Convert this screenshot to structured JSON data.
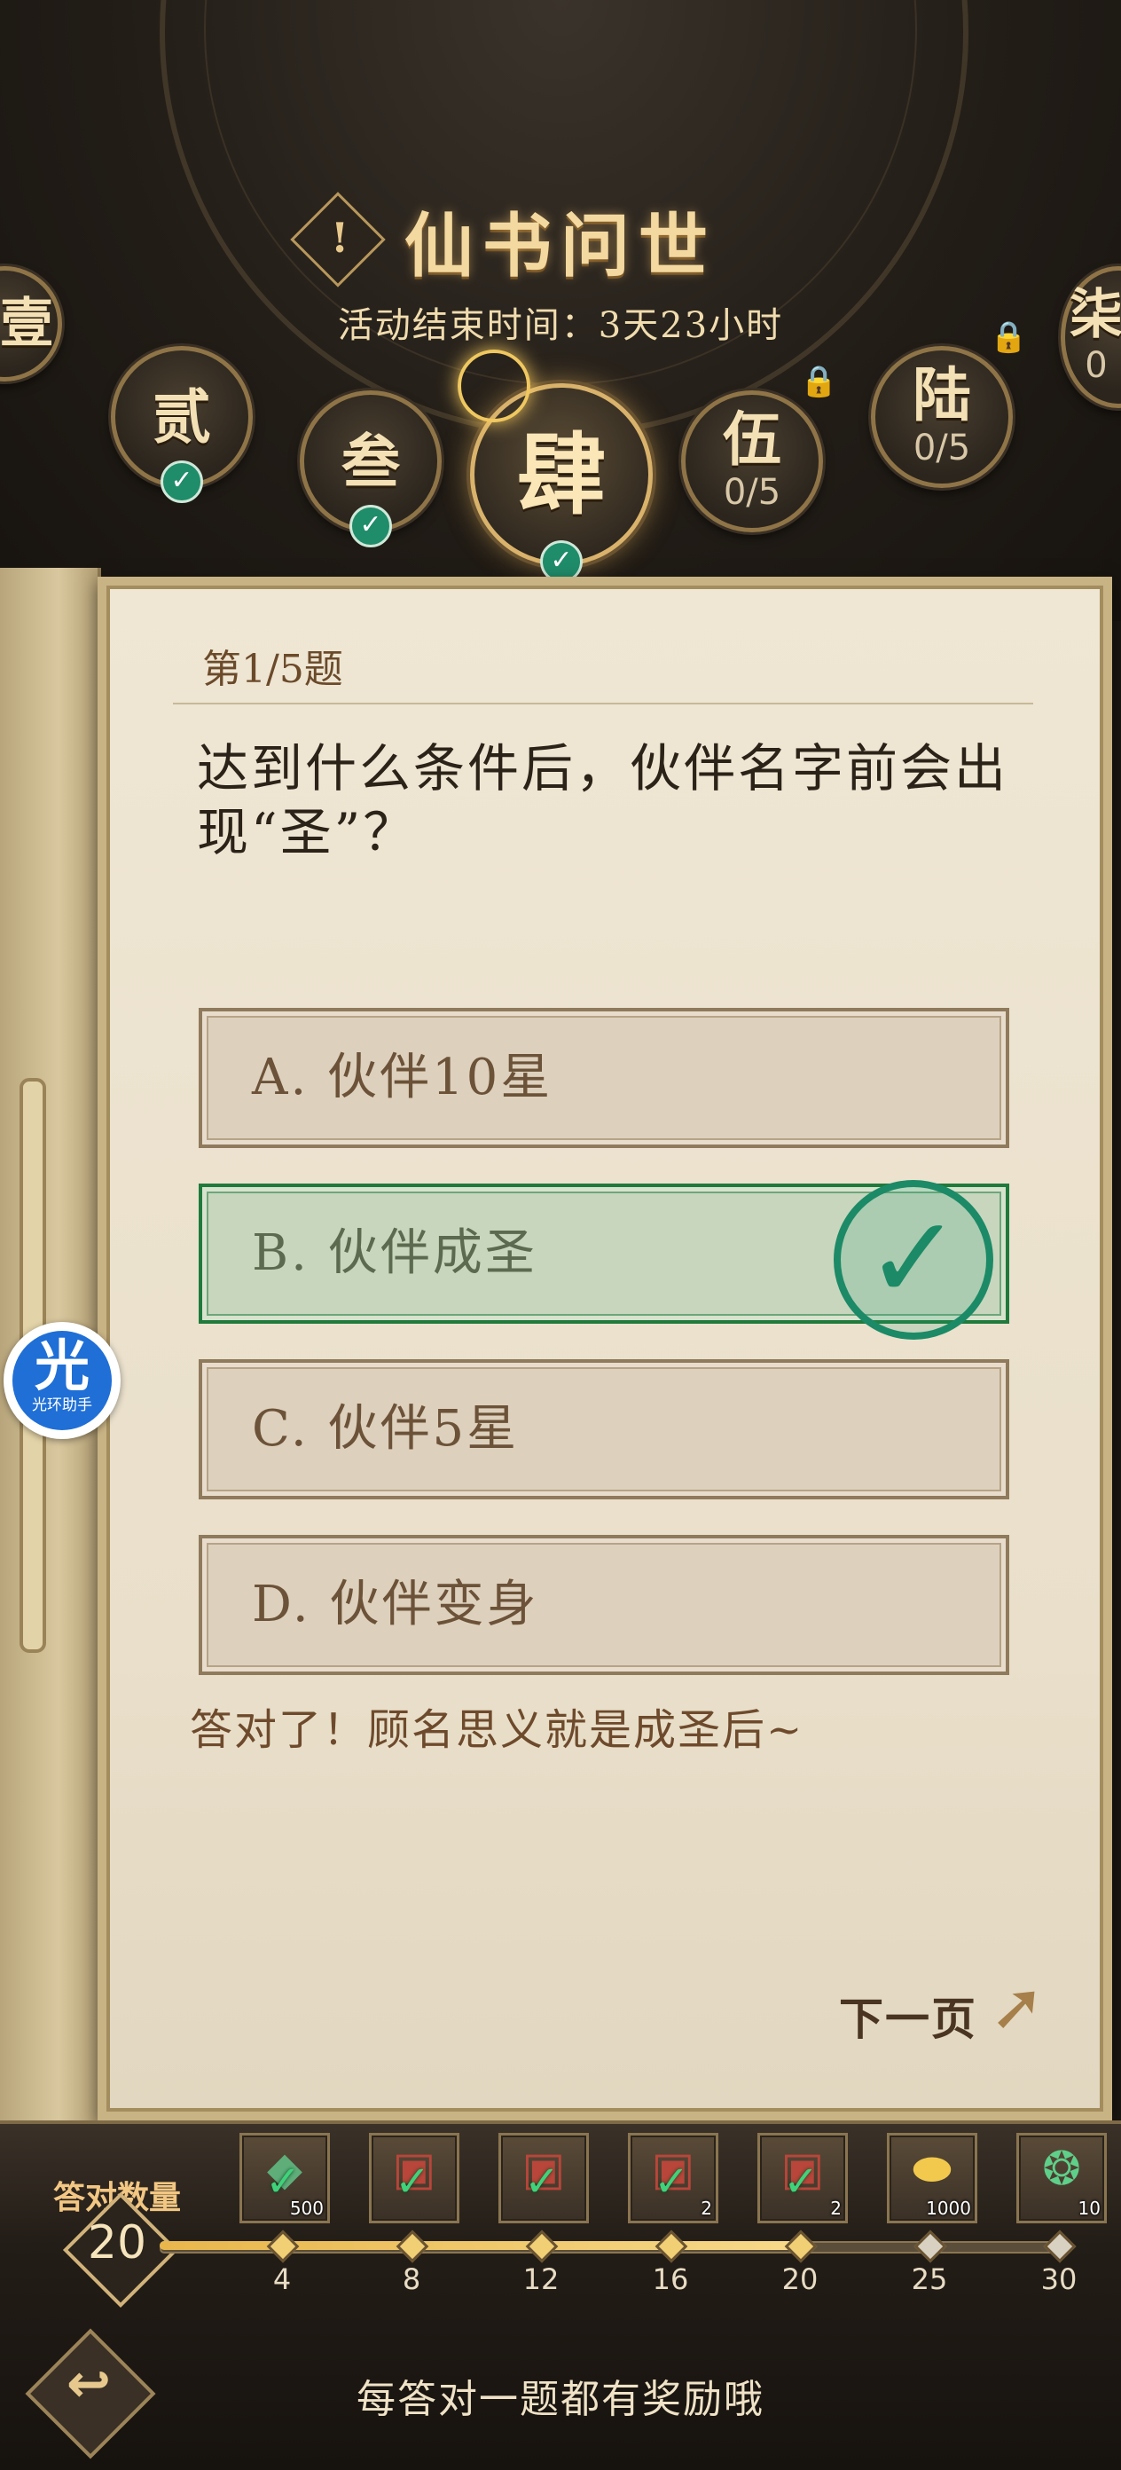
{
  "header": {
    "title": "仙书问世",
    "info_glyph": "!",
    "subtitle": "活动结束时间：3天23小时"
  },
  "chapters": [
    {
      "label": "壹",
      "progress": "",
      "completed": true,
      "locked": false
    },
    {
      "label": "贰",
      "progress": "",
      "completed": true,
      "locked": false
    },
    {
      "label": "叁",
      "progress": "",
      "completed": true,
      "locked": false
    },
    {
      "label": "肆",
      "progress": "",
      "completed": true,
      "locked": false,
      "active": true
    },
    {
      "label": "伍",
      "progress": "0/5",
      "completed": false,
      "locked": true
    },
    {
      "label": "陆",
      "progress": "0/5",
      "completed": false,
      "locked": true
    },
    {
      "label": "柒",
      "progress": "0",
      "completed": false,
      "locked": true
    }
  ],
  "quiz": {
    "number": "第1/5题",
    "question": "达到什么条件后，伙伴名字前会出现“圣”？",
    "options": [
      {
        "label": "A. 伙伴10星",
        "correct": false
      },
      {
        "label": "B. 伙伴成圣",
        "correct": true
      },
      {
        "label": "C. 伙伴5星",
        "correct": false
      },
      {
        "label": "D. 伙伴变身",
        "correct": false
      }
    ],
    "feedback": "答对了！顾名思义就是成圣后~",
    "next_label": "下一页"
  },
  "helper": {
    "big": "光",
    "small": "光环助手",
    "color": "#1f6fd6"
  },
  "rewards": {
    "count_label": "答对数量",
    "count_value": "20",
    "max": 30,
    "progress": 20,
    "milestones": [
      {
        "tick": "4",
        "qty": "500",
        "icon": "jade-icon",
        "claimed": true
      },
      {
        "tick": "8",
        "qty": "",
        "icon": "chest-icon",
        "claimed": true
      },
      {
        "tick": "12",
        "qty": "",
        "icon": "chest-icon",
        "claimed": true
      },
      {
        "tick": "16",
        "qty": "2",
        "icon": "chest-icon",
        "claimed": true
      },
      {
        "tick": "20",
        "qty": "2",
        "icon": "chest-icon",
        "claimed": true
      },
      {
        "tick": "25",
        "qty": "1000",
        "icon": "gold-ingot-icon",
        "claimed": false
      },
      {
        "tick": "30",
        "qty": "10",
        "icon": "green-gem-icon",
        "claimed": false
      }
    ],
    "tip": "每答对一题都有奖励哦"
  },
  "colors": {
    "accent_gold": "#f3d9a0",
    "correct_green": "#1c8a66"
  }
}
